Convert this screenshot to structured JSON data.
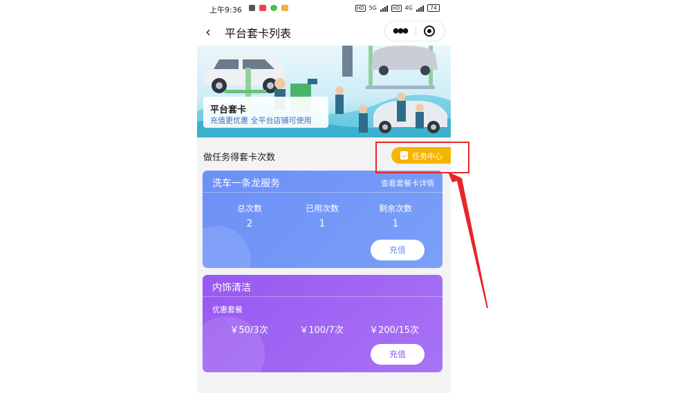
{
  "status_bar": {
    "time": "上午9:36",
    "network_left": "5G",
    "network_right": "4G",
    "battery": "74"
  },
  "nav": {
    "title": "平台套卡列表",
    "more_icon": "⦁⦁⦁"
  },
  "banner": {
    "title": "平台套卡",
    "subtitle": "充值更优惠   全平台店铺可使用"
  },
  "task": {
    "label": "做任务得套卡次数",
    "button": "任务中心"
  },
  "card1": {
    "title": "洗车一条龙服务",
    "link": "查看套餐卡详情",
    "stats": [
      {
        "label": "总次数",
        "value": "2"
      },
      {
        "label": "已用次数",
        "value": "1"
      },
      {
        "label": "剩余次数",
        "value": "1"
      }
    ],
    "button": "充值",
    "color": "#6f93f5"
  },
  "card2": {
    "title": "内饰清洁",
    "subtitle": "优惠套餐",
    "prices": [
      "￥50/3次",
      "￥100/7次",
      "￥200/15次"
    ],
    "button": "充值",
    "color": "#9a5cf2"
  },
  "annotation": {
    "color": "#e8262a"
  }
}
